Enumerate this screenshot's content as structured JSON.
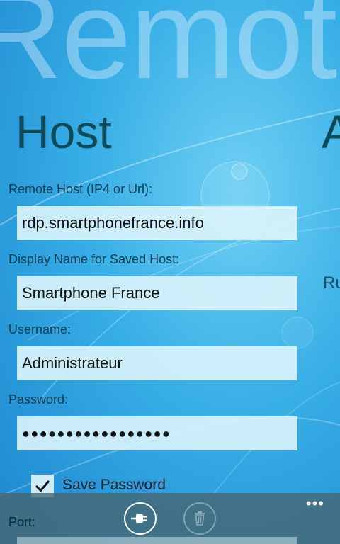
{
  "app": {
    "title": "Remote Desktop"
  },
  "pivot": {
    "current": "Host",
    "next": "A"
  },
  "peek_text": "Ru",
  "form": {
    "remote_host": {
      "label": "Remote Host (IP4 or Url):",
      "value": "rdp.smartphonefrance.info"
    },
    "display_name": {
      "label": "Display Name for Saved Host:",
      "value": "Smartphone France"
    },
    "username": {
      "label": "Username:",
      "value": "Administrateur"
    },
    "password": {
      "label": "Password:",
      "value": "●●●●●●●●●●●●●●●●●"
    },
    "save_password": {
      "label": "Save Password",
      "checked": true
    },
    "port": {
      "label": "Port:"
    }
  },
  "app_bar": {
    "buttons": [
      {
        "icon": "plug-icon",
        "enabled": true
      },
      {
        "icon": "trash-icon",
        "enabled": false
      }
    ],
    "more": "•••"
  },
  "colors": {
    "header_text": "#0d4b5a",
    "background": "#37aee6",
    "textbox": "#dcf4fc",
    "app_bar": "#46646e"
  }
}
